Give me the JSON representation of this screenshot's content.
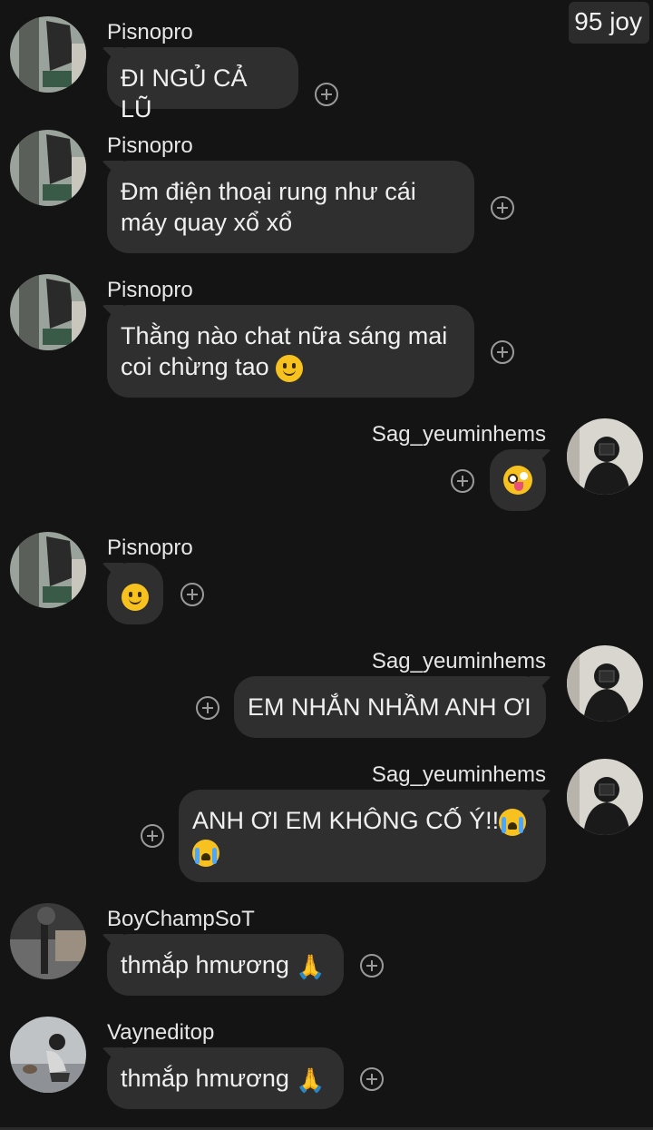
{
  "badge": "95 joy",
  "messages": [
    {
      "sender": "Pisnopro",
      "lines": [
        "ĐI NGỦ CẢ LŨ"
      ]
    },
    {
      "sender": "Pisnopro",
      "lines": [
        "Đm điện thoại rung như cái",
        "máy quay xổ xổ"
      ]
    },
    {
      "sender": "Pisnopro",
      "lines": [
        "Thằng nào chat nữa sáng mai",
        "coi chừng tao"
      ],
      "emoji": "slightly-smiling-emoji"
    },
    {
      "sender": "Sag_yeuminhems",
      "emoji": "zany-face-emoji"
    },
    {
      "sender": "Pisnopro",
      "emoji": "slightly-smiling-emoji"
    },
    {
      "sender": "Sag_yeuminhems",
      "lines": [
        "EM NHẮN NHẦM ANH ƠI"
      ]
    },
    {
      "sender": "Sag_yeuminhems",
      "lines": [
        "ANH ƠI EM KHÔNG CỐ Ý!!",
        ""
      ],
      "emoji": "loudly-crying-emoji"
    },
    {
      "sender": "BoyChampSoT",
      "lines": [
        "thmắp hmương"
      ],
      "emoji": "folded-hands-emoji"
    },
    {
      "sender": "Vayneditop",
      "lines": [
        "thmắp hmương"
      ],
      "emoji": "folded-hands-emoji"
    }
  ]
}
